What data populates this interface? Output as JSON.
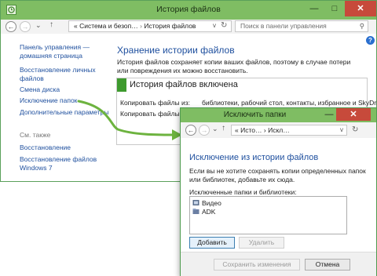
{
  "main_window": {
    "title": "История файлов",
    "controls": {
      "minimize": "—",
      "maximize": "□",
      "close": "✕"
    },
    "address": {
      "lead": "«",
      "crumb1": "Система и безоп…",
      "sep": "›",
      "crumb2": "История файлов",
      "dropdown": "v"
    },
    "search_placeholder": "Поиск в панели управления",
    "sidebar": {
      "home": "Панель управления —\nдомашняя страница",
      "restore": "Восстановление личных\nфайлов",
      "change_drive": "Смена диска",
      "exclude": "Исключение папок",
      "advanced": "Дополнительные параметры",
      "see_also_header": "См. также",
      "recovery": "Восстановление",
      "win7_backup": "Восстановление файлов\nWindows 7"
    },
    "content": {
      "heading": "Хранение истории файлов",
      "description": "История файлов сохраняет копии ваших файлов, поэтому в случае потери или повреждения их можно восстановить.",
      "status_title": "История файлов включена",
      "copy_from_label": "Копировать файлы из:",
      "copy_from_value": "библиотеки, рабочий стол, контакты, избранное и SkyDrive",
      "copy_to_label": "Копировать файлы в:"
    }
  },
  "dialog": {
    "title": "Исключить папки",
    "controls": {
      "minimize": "—",
      "close": "✕"
    },
    "address": {
      "lead": "«",
      "crumb1": "Исто…",
      "sep": "›",
      "crumb2": "Искл…",
      "dropdown": "v"
    },
    "heading": "Исключение из истории файлов",
    "description": "Если вы не хотите сохранять копии определенных папок или библиотек, добавьте их сюда.",
    "list_label": "Исключенные папки и библиотеки:",
    "items": [
      "Видео",
      "ADK"
    ],
    "add_button": "Добавить",
    "remove_button": "Удалить",
    "save_button": "Сохранить изменения",
    "cancel_button": "Отмена"
  },
  "colors": {
    "accent": "#7fbd63",
    "close": "#c74a3b",
    "link": "#1e4f9e",
    "status_green": "#3e9a2e",
    "arrow": "#6db33f"
  }
}
